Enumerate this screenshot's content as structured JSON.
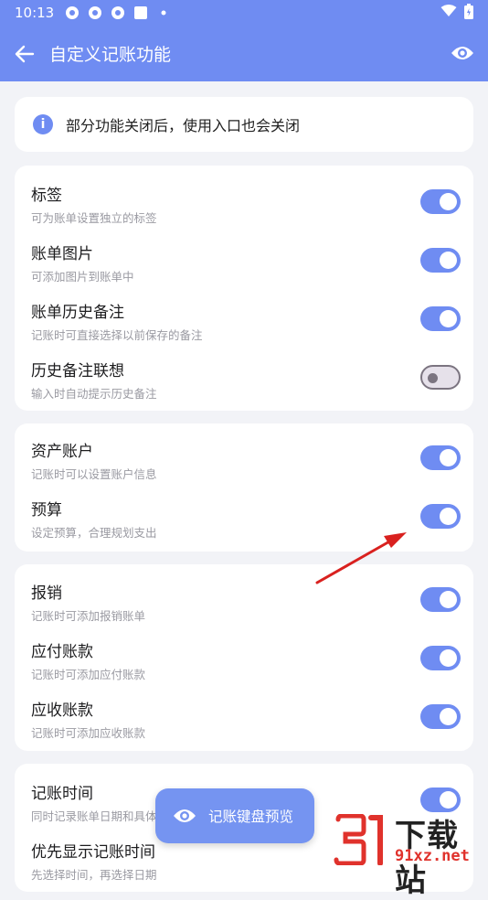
{
  "statusbar": {
    "time": "10:13"
  },
  "appbar": {
    "title": "自定义记账功能"
  },
  "info": {
    "text": "部分功能关闭后，使用入口也会关闭"
  },
  "groups": [
    {
      "items": [
        {
          "title": "标签",
          "subtitle": "可为账单设置独立的标签",
          "enabled": true
        },
        {
          "title": "账单图片",
          "subtitle": "可添加图片到账单中",
          "enabled": true
        },
        {
          "title": "账单历史备注",
          "subtitle": "记账时可直接选择以前保存的备注",
          "enabled": true
        },
        {
          "title": "历史备注联想",
          "subtitle": "输入时自动提示历史备注",
          "enabled": false
        }
      ]
    },
    {
      "items": [
        {
          "title": "资产账户",
          "subtitle": "记账时可以设置账户信息",
          "enabled": true
        },
        {
          "title": "预算",
          "subtitle": "设定预算，合理规划支出",
          "enabled": true
        }
      ]
    },
    {
      "items": [
        {
          "title": "报销",
          "subtitle": "记账时可添加报销账单",
          "enabled": true
        },
        {
          "title": "应付账款",
          "subtitle": "记账时可添加应付账款",
          "enabled": true
        },
        {
          "title": "应收账款",
          "subtitle": "记账时可添加应收账款",
          "enabled": true
        }
      ]
    },
    {
      "items": [
        {
          "title": "记账时间",
          "subtitle": "同时记录账单日期和具体",
          "enabled": true
        },
        {
          "title": "优先显示记账时间",
          "subtitle": "先选择时间，再选择日期",
          "enabled": true
        }
      ]
    }
  ],
  "fab": {
    "label": "记账键盘预览"
  },
  "watermark": {
    "line1": "下载站",
    "line2": "91xz.net"
  },
  "colors": {
    "primary": "#6f8cf2",
    "annotation_arrow": "#d9211f"
  }
}
